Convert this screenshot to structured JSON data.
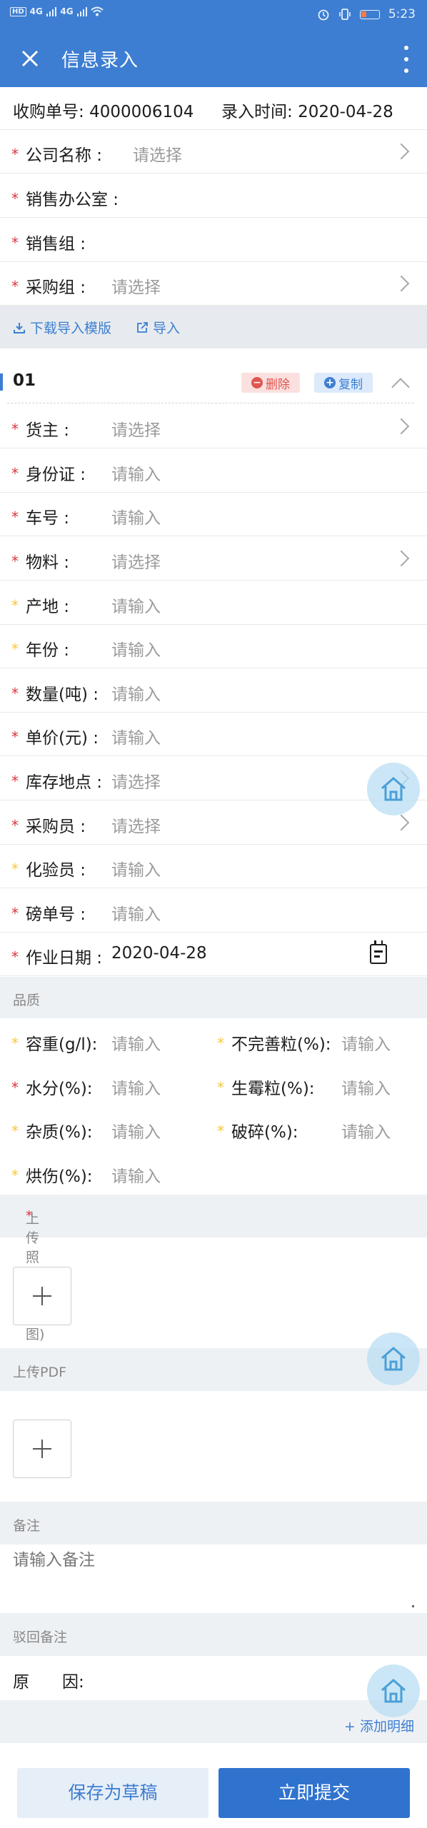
{
  "status_bar": {
    "network_badge": "HD",
    "signal_1": "4G",
    "signal_2": "4G",
    "time": "5:23"
  },
  "app_bar": {
    "title": "信息录入"
  },
  "order": {
    "number_label": "收购单号:",
    "number": "4000006104",
    "entry_time_label": "录入时间:",
    "entry_time": "2020-04-28"
  },
  "header_fields": [
    {
      "label": "公司名称 :",
      "value": "请选择",
      "required": true
    },
    {
      "label": "销售办公室 :",
      "value": "",
      "required": true
    },
    {
      "label": "销售组 :",
      "value": "",
      "required": true
    },
    {
      "label": "采购组 :",
      "value": "请选择",
      "required": true
    }
  ],
  "toolbar": {
    "download_template": "下载导入模版",
    "import": "导入"
  },
  "item": {
    "number": "01",
    "delete_label": "删除",
    "copy_label": "复制",
    "fields": [
      {
        "label": "货主 :",
        "value": "请选择"
      },
      {
        "label": "身份证 :",
        "value": "请输入"
      },
      {
        "label": "车号 :",
        "value": "请输入"
      },
      {
        "label": "物料 :",
        "value": "请选择"
      },
      {
        "label": "产地 :",
        "value": "请输入"
      },
      {
        "label": "年份 :",
        "value": "请输入"
      },
      {
        "label": "数量(吨) :",
        "value": "请输入"
      },
      {
        "label": "单价(元) :",
        "value": "请输入"
      },
      {
        "label": "库存地点 :",
        "value": "请选择"
      },
      {
        "label": "采购员 :",
        "value": "请选择"
      },
      {
        "label": "化验员 :",
        "value": "请输入"
      },
      {
        "label": "磅单号 :",
        "value": "请输入"
      },
      {
        "label": "作业日期 :",
        "value": "2020-04-28"
      }
    ]
  },
  "quality": {
    "section_title": "品质",
    "fields": [
      {
        "label": "容重(g/l):",
        "value": "请输入"
      },
      {
        "label": "不完善粒(%):",
        "value": "请输入"
      },
      {
        "label": "水分(%):",
        "value": "请输入"
      },
      {
        "label": "生霉粒(%):",
        "value": "请输入"
      },
      {
        "label": "杂质(%):",
        "value": "请输入"
      },
      {
        "label": "破碎(%):",
        "value": "请输入"
      },
      {
        "label": "烘伤(%):",
        "value": "请输入"
      }
    ]
  },
  "uploads": {
    "photo_title": "上传照片(磅单图)",
    "photo_required_mark": "*",
    "pdf_title": "上传PDF"
  },
  "remarks": {
    "title": "备注",
    "placeholder": "请输入备注"
  },
  "reject": {
    "title": "驳回备注",
    "reason_label": "原　　因:"
  },
  "add_detail": "+ 添加明细",
  "buttons": {
    "save_draft": "保存为草稿",
    "submit": "立即提交"
  },
  "colors": {
    "primary": "#3d7ed2",
    "required_star": "#d9363e",
    "optional_star": "#f6c743",
    "delete": "#e0554f"
  },
  "icons": [
    "close-icon",
    "more-vertical-icon",
    "download-icon",
    "import-icon",
    "delete-icon",
    "copy-icon",
    "chevron-right-icon",
    "chevron-up-icon",
    "calendar-icon",
    "plus-icon",
    "home-icon"
  ]
}
